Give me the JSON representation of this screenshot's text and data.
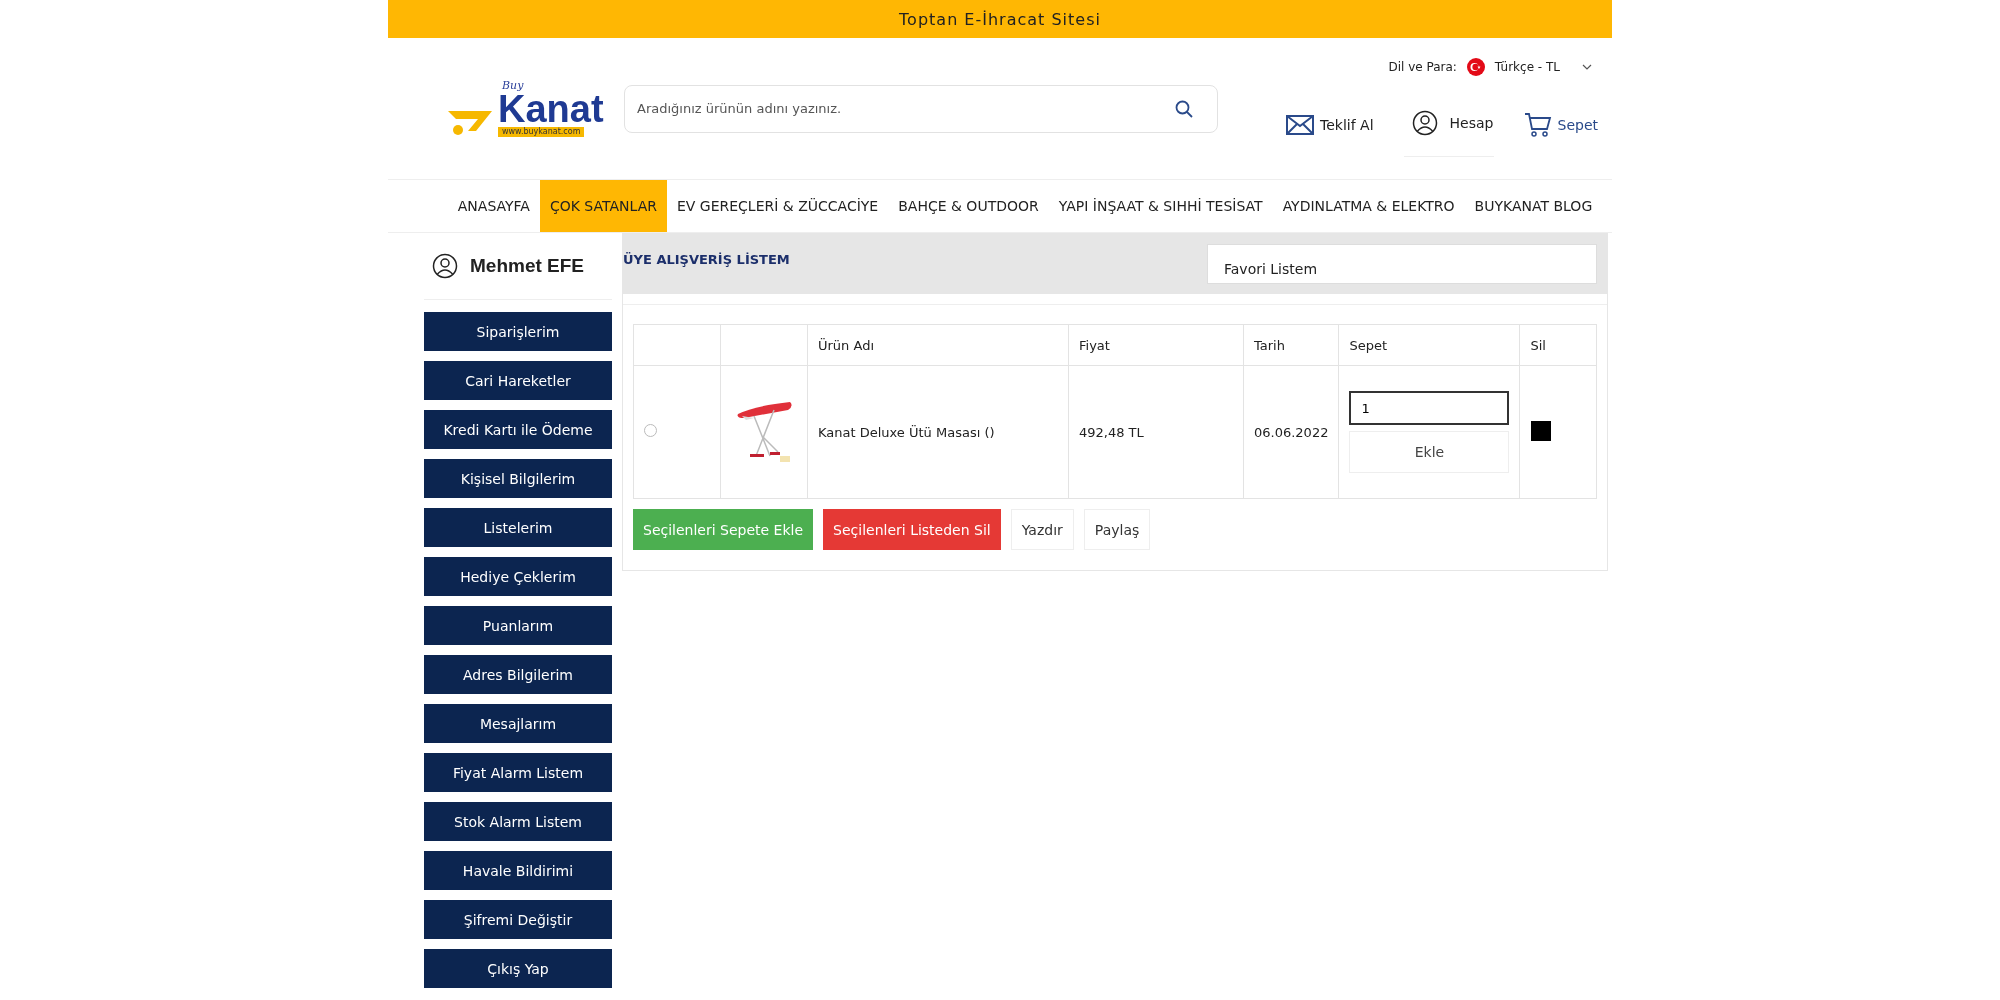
{
  "top_bar": {
    "text": "Toptan E-İhracat Sitesi"
  },
  "header": {
    "logo": {
      "small": "Buy",
      "name": "Kanat",
      "url": "www.buykanat.com"
    },
    "search": {
      "placeholder": "Aradığınız ürünün adını yazınız."
    },
    "language": {
      "label": "Dil ve Para:",
      "value": "Türkçe - TL"
    },
    "actions": [
      {
        "kind": "mail",
        "label": "Teklif Al"
      },
      {
        "kind": "user",
        "label": "Hesap"
      },
      {
        "kind": "cart",
        "label": "Sepet"
      }
    ]
  },
  "nav": [
    {
      "label": "ANASAYFA",
      "selected": false
    },
    {
      "label": "ÇOK SATANLAR",
      "selected": true
    },
    {
      "label": "EV GEREÇLERİ & ZÜCCACİYE",
      "selected": false
    },
    {
      "label": "BAHÇE & OUTDOOR",
      "selected": false
    },
    {
      "label": "YAPI İNŞAAT & SIHHİ TESİSAT",
      "selected": false
    },
    {
      "label": "AYDINLATMA & ELEKTRO",
      "selected": false
    },
    {
      "label": "BUYKANAT BLOG",
      "selected": false
    }
  ],
  "sidebar": {
    "user_name": "Mehmet EFE",
    "items": [
      "Siparişlerim",
      "Cari Hareketler",
      "Kredi Kartı ile Ödeme",
      "Kişisel Bilgilerim",
      "Listelerim",
      "Hediye Çeklerim",
      "Puanlarım",
      "Adres Bilgilerim",
      "Mesajlarım",
      "Fiyat Alarm Listem",
      "Stok Alarm Listem",
      "Havale Bildirimi",
      "Şifremi Değiştir",
      "Çıkış Yap"
    ]
  },
  "main": {
    "title": "ÜYE ALIŞVERİŞ LİSTEM",
    "list_select": {
      "value": "Favori Listem"
    },
    "table": {
      "columns": [
        "Ürün Adı",
        "Fiyat",
        "Tarih",
        "Sepet",
        "Sil"
      ],
      "rows": [
        {
          "selected": false,
          "name": "Kanat Deluxe Ütü Masası ()",
          "price": "492,48 TL",
          "date": "06.06.2022",
          "quantity": "1",
          "add_button": "Ekle"
        }
      ]
    },
    "buttons": [
      {
        "kind": "green",
        "label": "Seçilenleri Sepete Ekle"
      },
      {
        "kind": "red",
        "label": "Seçilenleri Listeden Sil"
      },
      {
        "kind": "plain",
        "label": "Yazdır"
      },
      {
        "kind": "plain",
        "label": "Paylaş"
      }
    ]
  }
}
